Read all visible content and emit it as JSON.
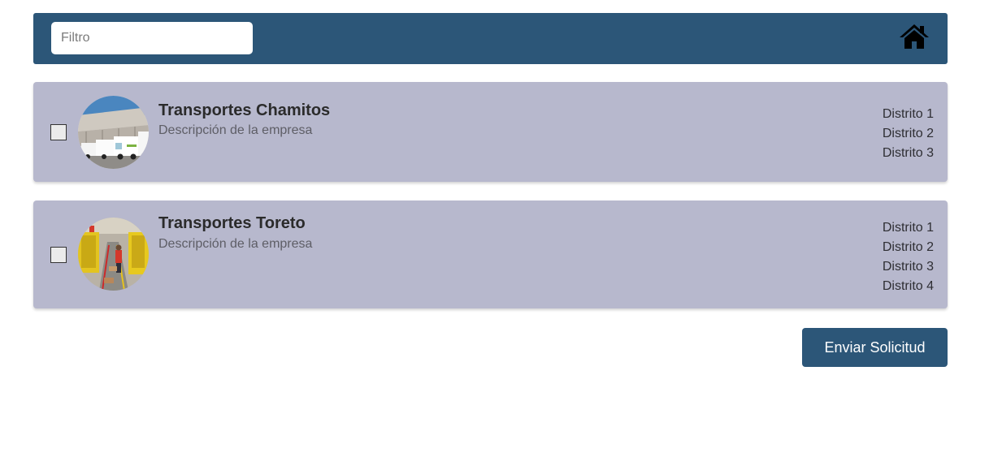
{
  "header": {
    "filter_placeholder": "Filtro",
    "filter_value": "",
    "home_icon": "home-icon",
    "background_color": "#2c5678"
  },
  "companies": [
    {
      "name": "Transportes Chamitos",
      "description": "Descripción de la empresa",
      "checked": false,
      "avatar": "photo-trucks-warehouse",
      "districts": [
        "Distrito 1",
        "Distrito 2",
        "Distrito 3"
      ]
    },
    {
      "name": "Transportes Toreto",
      "description": "Descripción de la empresa",
      "checked": false,
      "avatar": "photo-warehouse-workers",
      "districts": [
        "Distrito 1",
        "Distrito 2",
        "Distrito 3",
        "Distrito 4"
      ]
    }
  ],
  "actions": {
    "submit_label": "Enviar Solicitud"
  },
  "colors": {
    "accent": "#2c5678",
    "card_background": "#b7b8cd"
  }
}
